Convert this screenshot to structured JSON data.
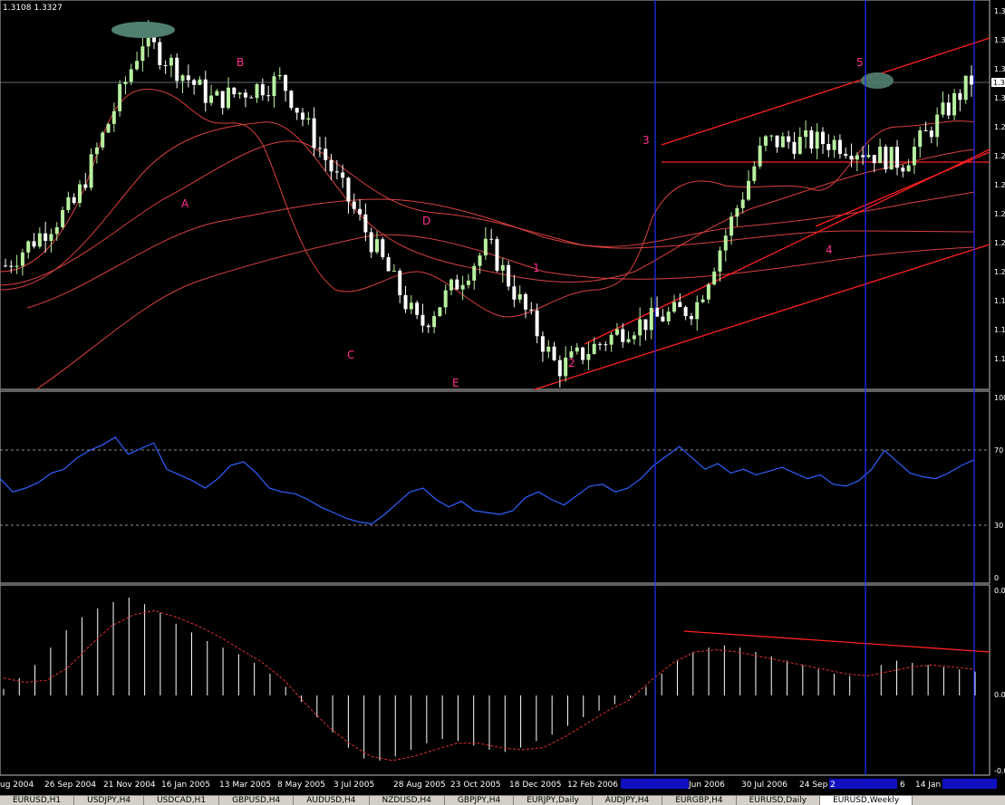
{
  "chart_title": "1.3108 1.3327",
  "price_label": "1.3",
  "colors": {
    "background": "#000000",
    "bull_candle": "#b8f0a0",
    "bear_candle": "#ffffff",
    "ma": "#d84040",
    "channel": "#ff2020",
    "rsi": "#3060ff",
    "macd_hist": "#ffffff",
    "signal": "#e03030",
    "vline": "#2030ff",
    "wave_label": "#ff3090",
    "ellipse": "#508070"
  },
  "x_axis": [
    "ug 2004",
    "26 Sep 2004",
    "21 Nov 2004",
    "16 Jan 2005",
    "13 Mar 2005",
    "8 May 2005",
    "3 Jul 2005",
    "28 Aug 2005",
    "23 Oct 2005",
    "18 Dec 2005",
    "12 Feb 2006",
    "Jun 2006",
    "30 Jul 2006",
    "24 Sep 2",
    "6",
    "14 Jan"
  ],
  "price_axis": [
    "1.3",
    "1.3",
    "1.3",
    "1.3",
    "1.2",
    "1.2",
    "1.2",
    "1.2",
    "1.2",
    "1.2",
    "1.1",
    "1.1",
    "1.1"
  ],
  "wave_labels": [
    "A",
    "B",
    "C",
    "D",
    "E",
    "1",
    "2",
    "3",
    "4",
    "5"
  ],
  "rsi_axis": [
    "100",
    "70",
    "30",
    "0"
  ],
  "macd_axis": [
    "0.0",
    "0.0",
    "-0.0"
  ],
  "chart_data": [
    {
      "type": "candlestick",
      "title": "EURUSD,Weekly",
      "x": [
        "ug 2004",
        "26 Sep 2004",
        "21 Nov 2004",
        "16 Jan 2005",
        "13 Mar 2005",
        "8 May 2005",
        "3 Jul 2005",
        "28 Aug 2005",
        "23 Oct 2005",
        "18 Dec 2005",
        "12 Feb 2006",
        "Jun 2006",
        "30 Jul 2006",
        "24 Sep 2",
        "14 Jan"
      ],
      "close": [
        1.22,
        1.25,
        1.33,
        1.3,
        1.31,
        1.25,
        1.19,
        1.23,
        1.17,
        1.19,
        1.2,
        1.28,
        1.28,
        1.27,
        1.31
      ]
    },
    {
      "type": "line",
      "title": "RSI",
      "ylim": [
        0,
        100
      ],
      "levels": [
        70,
        30
      ],
      "values": [
        55,
        48,
        50,
        53,
        58,
        60,
        66,
        70,
        73,
        77,
        68,
        71,
        74,
        60,
        57,
        54,
        50,
        55,
        62,
        64,
        58,
        50,
        48,
        47,
        44,
        40,
        37,
        34,
        32,
        31,
        36,
        42,
        48,
        50,
        44,
        40,
        43,
        38,
        37,
        36,
        38,
        45,
        48,
        44,
        41,
        46,
        51,
        52,
        48,
        50,
        55,
        62,
        67,
        72,
        66,
        60,
        63,
        58,
        60,
        57,
        59,
        61,
        58,
        55,
        57,
        52,
        51,
        54,
        60,
        70,
        64,
        58,
        56,
        55,
        58,
        62,
        65
      ]
    },
    {
      "type": "bar",
      "title": "MACD",
      "values": [
        0.3,
        0.8,
        1.4,
        2.2,
        3.0,
        3.6,
        4.0,
        4.3,
        4.5,
        4.2,
        3.8,
        3.3,
        2.9,
        2.5,
        2.2,
        1.9,
        1.5,
        1.0,
        0.4,
        -0.3,
        -1.0,
        -1.7,
        -2.4,
        -2.9,
        -3.0,
        -2.8,
        -2.5,
        -2.2,
        -2.0,
        -2.1,
        -2.3,
        -2.5,
        -2.6,
        -2.4,
        -2.1,
        -1.8,
        -1.4,
        -1.0,
        -0.7,
        -0.4,
        -0.1,
        0.4,
        1.0,
        1.6,
        2.0,
        2.2,
        2.3,
        2.2,
        2.0,
        1.8,
        1.6,
        1.4,
        1.2,
        1.0,
        0.9,
        1.1,
        1.4,
        1.6,
        1.5,
        1.4,
        1.3,
        1.2,
        1.1
      ],
      "signal": [
        0.8,
        0.6,
        0.7,
        1.3,
        2.3,
        3.2,
        3.7,
        3.9,
        3.6,
        3.2,
        2.7,
        2.1,
        1.5,
        0.7,
        -0.4,
        -1.4,
        -2.2,
        -2.8,
        -3.0,
        -2.8,
        -2.5,
        -2.2,
        -2.2,
        -2.4,
        -2.5,
        -2.4,
        -1.9,
        -1.3,
        -0.7,
        -0.2,
        0.7,
        1.5,
        2.0,
        2.1,
        2.0,
        1.8,
        1.6,
        1.4,
        1.2,
        1.0,
        0.9,
        1.1,
        1.3,
        1.4,
        1.3,
        1.2
      ]
    }
  ],
  "tabs": [
    "EURUSD,H1",
    "USDJPY,H4",
    "USDCAD,H1",
    "GBPUSD,H4",
    "AUDUSD,H4",
    "NZDUSD,H4",
    "GBPJPY,H4",
    "EURJPY,Daily",
    "AUDJPY,H4",
    "EURGBP,H4",
    "EURUSD,Daily",
    "EURUSD,Weekly"
  ],
  "active_tab_index": 11
}
